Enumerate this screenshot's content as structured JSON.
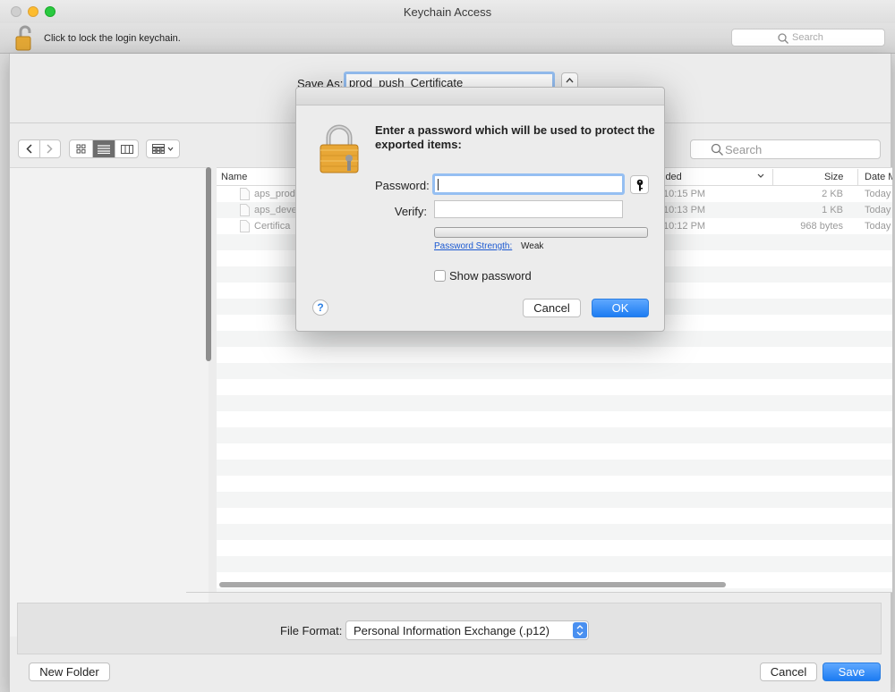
{
  "window": {
    "title": "Keychain Access",
    "lock_message": "Click to lock the login keychain.",
    "search_placeholder": "Search"
  },
  "save_sheet": {
    "save_as_label": "Save As:",
    "save_as_value": "prod_push_Certificate",
    "search_placeholder": "Search",
    "columns": {
      "name": "Name",
      "date_added": "lded",
      "size": "Size",
      "date_modified": "Date M"
    },
    "files": [
      {
        "name": "aps_prod",
        "added": "10:15 PM",
        "size": "2 KB",
        "date": "Today"
      },
      {
        "name": "aps_deve",
        "added": "10:13 PM",
        "size": "1 KB",
        "date": "Today"
      },
      {
        "name": "Certifica",
        "added": "10:12 PM",
        "size": "968 bytes",
        "date": "Today"
      }
    ],
    "file_format_label": "File Format:",
    "file_format_value": "Personal Information Exchange (.p12)",
    "new_folder_label": "New Folder",
    "cancel_label": "Cancel",
    "save_label": "Save"
  },
  "password_dialog": {
    "message": "Enter a password which will be used to protect the exported items:",
    "password_label": "Password:",
    "password_value": "",
    "verify_label": "Verify:",
    "verify_value": "",
    "strength_link": "Password Strength:",
    "strength_value": "Weak",
    "strength_level": 0,
    "show_password_label": "Show password",
    "show_password_checked": false,
    "help_label": "?",
    "cancel_label": "Cancel",
    "ok_label": "OK"
  },
  "colors": {
    "accent": "#1d7cf2",
    "focus_ring": "#95bff2",
    "link": "#1b59d1"
  },
  "icons": [
    "lock-icon",
    "search-icon",
    "chevron-left-icon",
    "chevron-right-icon",
    "icon-view-icon",
    "list-view-icon",
    "column-view-icon",
    "arrange-icon",
    "document-icon",
    "key-icon",
    "help-icon",
    "stepper-icon"
  ]
}
